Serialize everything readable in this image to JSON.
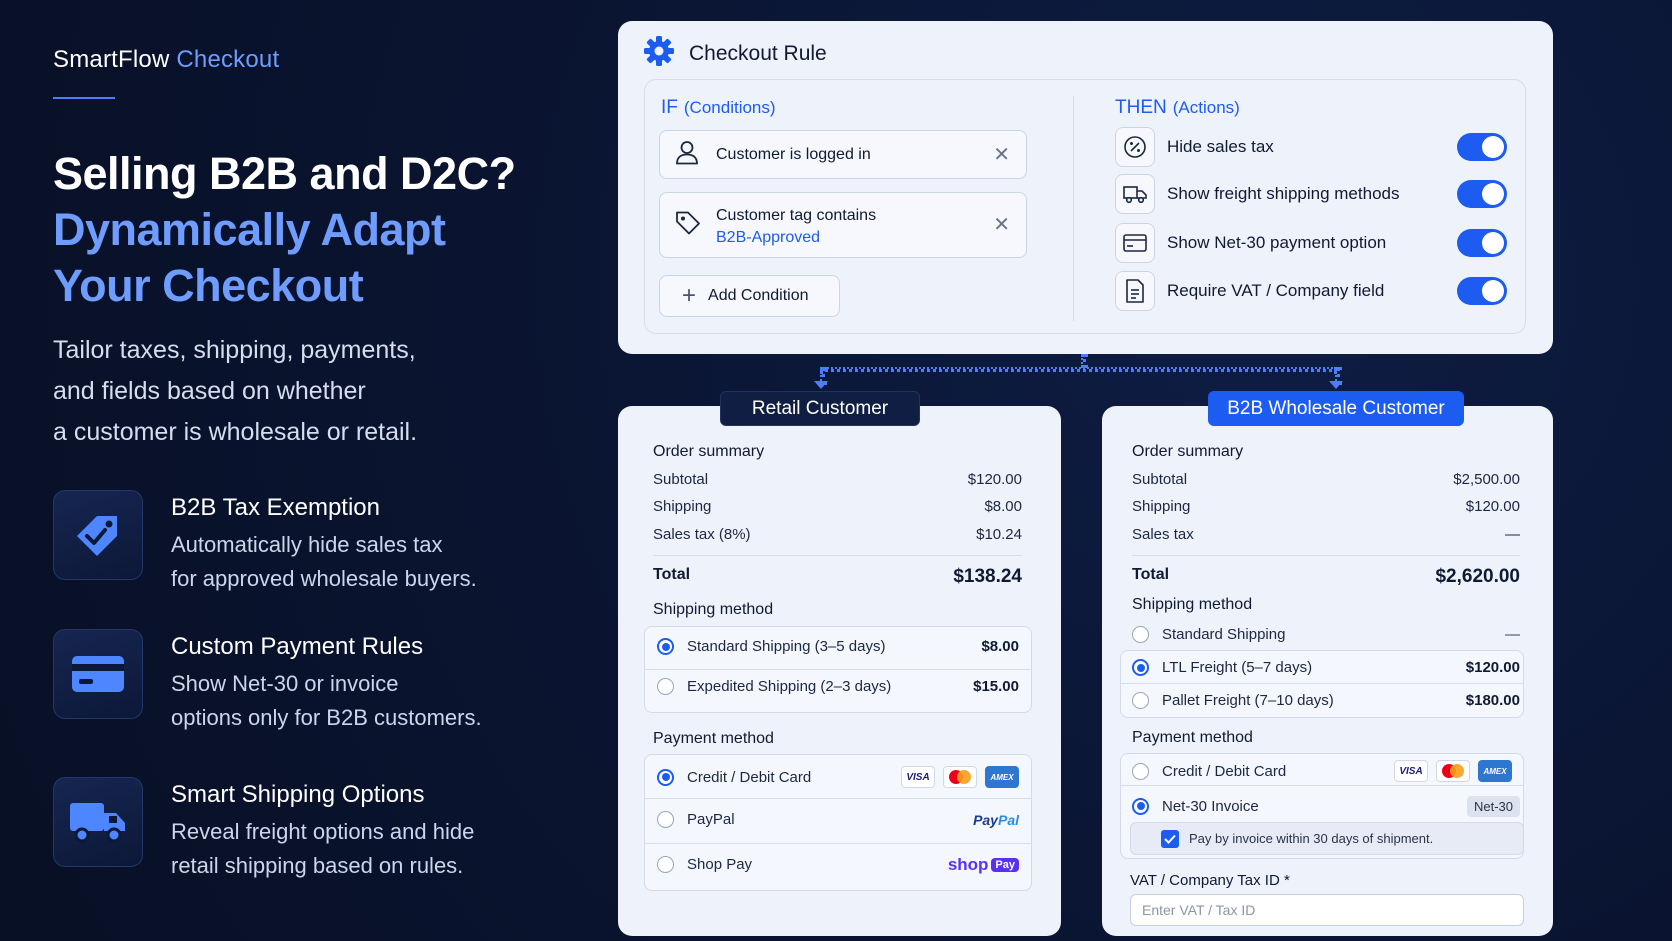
{
  "brand": {
    "name": "SmartFlow",
    "accent": "Checkout"
  },
  "hero": {
    "line1": "Selling B2B and D2C?",
    "line2": "Dynamically Adapt",
    "line3": "Your Checkout"
  },
  "subtitle": {
    "line1": "Tailor taxes, shipping, payments,",
    "line2": "and fields based on whether",
    "line3": "a customer is wholesale or retail."
  },
  "features": [
    {
      "title": "B2B Tax Exemption",
      "desc1": "Automatically hide sales tax",
      "desc2": "for approved wholesale buyers.",
      "icon": "tag-check-icon"
    },
    {
      "title": "Custom Payment Rules",
      "desc1": "Show Net-30 or invoice",
      "desc2": "options only for B2B customers.",
      "icon": "credit-card-icon"
    },
    {
      "title": "Smart Shipping Options",
      "desc1": "Reveal freight options and hide",
      "desc2": "retail shipping based on rules.",
      "icon": "truck-icon"
    }
  ],
  "rule": {
    "title": "Checkout Rule",
    "if_label": "IF",
    "if_sub": "(Conditions)",
    "then_label": "THEN",
    "then_sub": "(Actions)",
    "conditions": [
      {
        "label": "Customer is logged in",
        "value": ""
      },
      {
        "label": "Customer tag contains",
        "value": "B2B-Approved"
      }
    ],
    "add_condition": "Add Condition",
    "actions": [
      {
        "label": "Hide sales tax",
        "enabled": true,
        "icon": "percent-icon"
      },
      {
        "label": "Show freight shipping methods",
        "enabled": true,
        "icon": "truck-icon"
      },
      {
        "label": "Show Net-30 payment option",
        "enabled": true,
        "icon": "card-icon"
      },
      {
        "label": "Require VAT / Company field",
        "enabled": true,
        "icon": "document-icon"
      }
    ]
  },
  "retail": {
    "tab": "Retail Customer",
    "order_summary": "Order summary",
    "subtotal_label": "Subtotal",
    "subtotal": "$120.00",
    "shipping_label": "Shipping",
    "shipping": "$8.00",
    "tax_label": "Sales tax (8%)",
    "tax": "$10.24",
    "total_label": "Total",
    "total": "$138.24",
    "shipping_method": "Shipping method",
    "ship_options": [
      {
        "label": "Standard Shipping (3–5 days)",
        "price": "$8.00",
        "selected": true
      },
      {
        "label": "Expedited Shipping (2–3 days)",
        "price": "$15.00",
        "selected": false
      }
    ],
    "payment_method": "Payment method",
    "pay_options": [
      {
        "label": "Credit / Debit Card",
        "selected": true
      },
      {
        "label": "PayPal",
        "selected": false
      },
      {
        "label": "Shop Pay",
        "selected": false
      }
    ]
  },
  "b2b": {
    "tab": "B2B Wholesale Customer",
    "order_summary": "Order summary",
    "subtotal_label": "Subtotal",
    "subtotal": "$2,500.00",
    "shipping_label": "Shipping",
    "shipping": "$120.00",
    "tax_label": "Sales tax",
    "tax": "—",
    "total_label": "Total",
    "total": "$2,620.00",
    "shipping_method": "Shipping method",
    "ship_options": [
      {
        "label": "Standard Shipping",
        "price": "—",
        "selected": false
      },
      {
        "label": "LTL Freight (5–7 days)",
        "price": "$120.00",
        "selected": true
      },
      {
        "label": "Pallet Freight (7–10 days)",
        "price": "$180.00",
        "selected": false
      }
    ],
    "payment_method": "Payment method",
    "pay_options": [
      {
        "label": "Credit / Debit Card",
        "selected": false
      },
      {
        "label": "Net-30 Invoice",
        "selected": true,
        "badge": "Net-30"
      }
    ],
    "invoice_note": "Pay by invoice within 30 days of shipment.",
    "vat_label": "VAT / Company Tax ID *",
    "vat_placeholder": "Enter VAT / Tax ID"
  },
  "payment_logos": {
    "visa": "VISA",
    "amex": "AMEX",
    "paypal_a": "Pay",
    "paypal_b": "Pal",
    "shop": "shop",
    "shop_pay": "Pay"
  },
  "colors": {
    "background": "#0a1430",
    "accent": "#1d5cf0",
    "accent_light": "#6f9cff",
    "card": "#eef2fb"
  }
}
